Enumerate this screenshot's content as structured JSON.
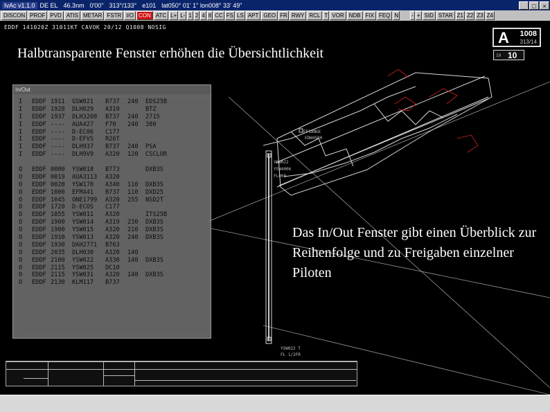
{
  "titlebar": {
    "app": "IvAc v1.1.0",
    "callsign": "DE EL",
    "range": "46.3nm",
    "alt": "0'00\"",
    "coords": "313°/133°",
    "mode": "e101",
    "lat": "lat050° 01' 1\" lon008° 33' 49\"",
    "window_buttons": [
      "_",
      "□",
      "×"
    ]
  },
  "toolbar": {
    "left_buttons": [
      "DISCON",
      "PROF",
      "PVD",
      "ATIS",
      "METAR",
      "FSTR",
      "I/O",
      "CON",
      "ATC",
      "L+",
      "L-",
      "1",
      "2",
      "4",
      "8",
      "CC",
      "FS",
      "LS",
      "APT",
      "GEO",
      "FR",
      "RWY",
      "RCL",
      "T",
      "VOR",
      "NDB",
      "FIX",
      "FEQ",
      "N"
    ],
    "right_buttons": [
      "-",
      "+",
      "SID",
      "STAR",
      "Z1",
      "Z2",
      "Z3",
      "Z4"
    ]
  },
  "infoline": "EDDF 141020Z 31011KT CAVOK 20/12 Q1008 NOSIG",
  "atis": {
    "letter": "A",
    "qnh": "1008",
    "wind": "313/14"
  },
  "runway": {
    "small": "19",
    "large": "10"
  },
  "captions": {
    "top": "Halbtransparente Fenster erhöhen die Übersichtlichkeit",
    "bottom": "Das In/Out Fenster gibt einen Überblick zur Reihenfolge und zu Freigaben einzelner Piloten"
  },
  "inout": {
    "title": "In/Out",
    "inbound": [
      [
        "I",
        "EDDF",
        "1911",
        "GSW021",
        "B737",
        "240",
        "EDS25B"
      ],
      [
        "I",
        "EDDF",
        "1928",
        "DLH029",
        "A319",
        "",
        "BTZ"
      ],
      [
        "I",
        "EDDF",
        "1937",
        "DLH3208",
        "B737",
        "240",
        "2715"
      ],
      [
        "I",
        "EDDF",
        "----",
        "AUA427",
        "F70",
        "240",
        "380"
      ],
      [
        "I",
        "EDDF",
        "----",
        "D-EC06",
        "C177",
        "",
        ""
      ],
      [
        "I",
        "EDDF",
        "----",
        "D-EFVS",
        "R26T",
        "",
        ""
      ],
      [
        "I",
        "EDDF",
        "----",
        "DLH937",
        "B737",
        "240",
        "PSA"
      ],
      [
        "I",
        "EDDF",
        "----",
        "DLH9V9",
        "A320",
        "120",
        "CSCLOR"
      ]
    ],
    "outbound": [
      [
        "O",
        "EDDF",
        "0000",
        "YSW018",
        "B773",
        "",
        "DXB3S"
      ],
      [
        "O",
        "EDDF",
        "0019",
        "AUA3113",
        "A320",
        "",
        ""
      ],
      [
        "O",
        "EDDF",
        "0020",
        "YSW170",
        "A340",
        "110",
        "DXB3S"
      ],
      [
        "O",
        "EDDF",
        "1000",
        "EFM441",
        "B737",
        "110",
        "DXD25"
      ],
      [
        "O",
        "EDDF",
        "1045",
        "ONE1799",
        "A320",
        "255",
        "NSD2T"
      ],
      [
        "O",
        "EDDF",
        "1720",
        "D-ECOS",
        "C177",
        "",
        ""
      ],
      [
        "O",
        "EDDF",
        "1855",
        "YSW011",
        "A320",
        "",
        "ITS25B"
      ],
      [
        "O",
        "EDDF",
        "1900",
        "YSW014",
        "A319",
        "230",
        "DXB3S"
      ],
      [
        "O",
        "EDDF",
        "1900",
        "YSW015",
        "A320",
        "210",
        "DXB3S"
      ],
      [
        "O",
        "EDDF",
        "1910",
        "YSW013",
        "A320",
        "240",
        "DXB3S"
      ],
      [
        "O",
        "EDDF",
        "1930",
        "DAH2771",
        "B763",
        "",
        ""
      ],
      [
        "O",
        "EDDF",
        "2035",
        "DLH030",
        "A320",
        "140",
        ""
      ],
      [
        "O",
        "EDDF",
        "2100",
        "YSW022",
        "A330",
        "140",
        "DXB3S"
      ],
      [
        "O",
        "EDDF",
        "2115",
        "YSW025",
        "DC10",
        "",
        ""
      ],
      [
        "O",
        "EDDF",
        "2115",
        "YSW031",
        "A320",
        "140",
        "DXB3S"
      ],
      [
        "O",
        "EDDF",
        "2130",
        "KLM117",
        "B737",
        "",
        ""
      ]
    ]
  },
  "tags": {
    "t1": "EF1ANGE",
    "t2": "EDW4S00",
    "t3": "YSW022",
    "t4": "YSW4006",
    "t5": "FL008",
    "t6": "YSW022 T",
    "t7": "FL 1/2FR"
  },
  "colors": {
    "background": "#000000",
    "toolbar": "#c0c0c0",
    "titlebar": "#0a246a",
    "active_button": "#d01010"
  }
}
